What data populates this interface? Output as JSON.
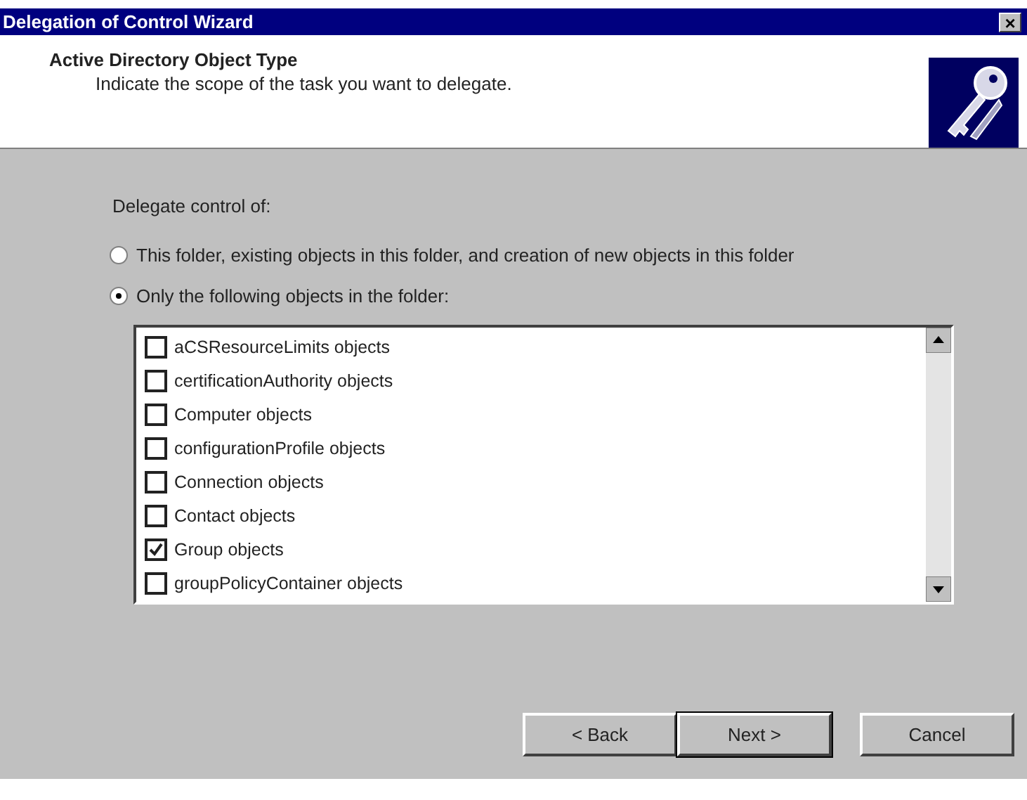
{
  "window": {
    "title": "Delegation of Control Wizard",
    "close": "×"
  },
  "header": {
    "title": "Active Directory Object Type",
    "subtitle": "Indicate the scope of the task you want to delegate."
  },
  "group_label": "Delegate control of:",
  "options": [
    {
      "label": "This folder, existing objects in this folder, and creation of new objects in this folder",
      "selected": false
    },
    {
      "label": "Only the following objects in the folder:",
      "selected": true
    }
  ],
  "objects": [
    {
      "label": "aCSResourceLimits objects",
      "checked": false
    },
    {
      "label": "certificationAuthority objects",
      "checked": false
    },
    {
      "label": "Computer objects",
      "checked": false
    },
    {
      "label": "configurationProfile objects",
      "checked": false
    },
    {
      "label": "Connection objects",
      "checked": false
    },
    {
      "label": "Contact objects",
      "checked": false
    },
    {
      "label": "Group objects",
      "checked": true
    },
    {
      "label": "groupPolicyContainer objects",
      "checked": false
    }
  ],
  "buttons": [
    {
      "label": "< Back",
      "default": false
    },
    {
      "label": "Next >",
      "default": true
    },
    {
      "label": "Cancel",
      "default": false
    }
  ]
}
